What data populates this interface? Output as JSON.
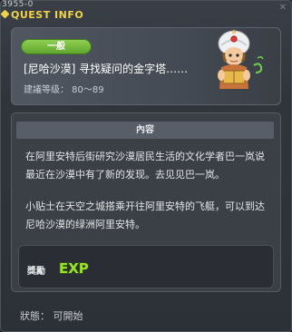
{
  "window": {
    "code": "3955-0",
    "title": "QUEST INFO"
  },
  "quest": {
    "category": "一般",
    "name": "[尼哈沙漠] 寻找疑问的金字塔……",
    "level_requirement": "建議等级： 80～89"
  },
  "content": {
    "section_title": "內容",
    "description_1": "在阿里安特后街研究沙漠居民生活的文化学者巴一岚说最近在沙漠中有了新的发现。去见见巴一岚。",
    "description_2": "小贴士在天空之城搭乘开往阿里安特的飞艇，可以到达尼哈沙漠的绿洲阿里安特。"
  },
  "reward": {
    "label": "獎勵",
    "exp_text": "EXP"
  },
  "status": {
    "text": "狀態：  可開始"
  },
  "colors": {
    "title": "#f0d24a",
    "badge": "#6bb536",
    "exp": "#9be02a"
  },
  "icons": [
    "npc-portrait",
    "exp-icon",
    "title-diamond-icon"
  ]
}
